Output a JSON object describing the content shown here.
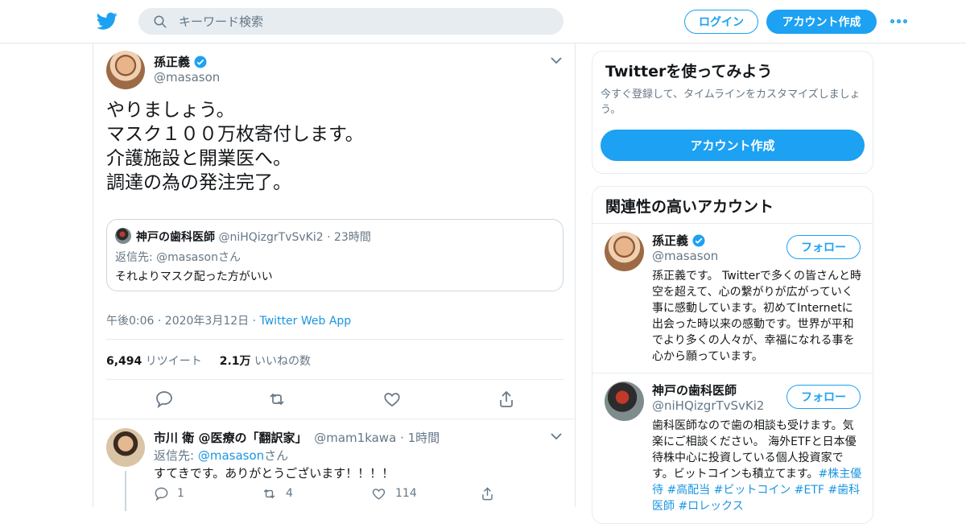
{
  "header": {
    "search_placeholder": "キーワード検索",
    "login_label": "ログイン",
    "signup_label": "アカウント作成"
  },
  "tweet": {
    "author_name": "孫正義",
    "author_handle": "@masason",
    "text_lines": [
      "やりましょう。",
      "マスク１００万枚寄付します。",
      "介護施設と開業医へ。",
      "調達の為の発注完了。"
    ],
    "quote": {
      "author_name": "神戸の歯科医師",
      "author_handle": "@niHQizgrTvSvKi2",
      "time": "23時間",
      "reply_to": "返信先: @masasonさん",
      "text": "それよりマスク配った方がいい"
    },
    "timestamp": "午後0:06 · 2020年3月12日",
    "source": "Twitter Web App",
    "retweets_count": "6,494",
    "retweets_label": "リツイート",
    "likes_count": "2.1万",
    "likes_label": "いいねの数"
  },
  "reply": {
    "author_name": "市川 衛 @医療の「翻訳家」",
    "author_handle": "@mam1kawa",
    "time": "1時間",
    "reply_to_prefix": "返信先: ",
    "reply_to_handle": "@masason",
    "reply_to_suffix": "さん",
    "text": "すてきです。ありがとうございます！！！！",
    "reply_count": "1",
    "retweet_count": "4",
    "like_count": "114"
  },
  "sidebar": {
    "signup_card": {
      "title": "Twitterを使ってみよう",
      "desc": "今すぐ登録して、タイムラインをカスタマイズしましょう。",
      "button_label": "アカウント作成"
    },
    "related": {
      "title": "関連性の高いアカウント",
      "follow_label": "フォロー",
      "accounts": [
        {
          "name": "孫正義",
          "handle": "@masason",
          "bio": "孫正義です。 Twitterで多くの皆さんと時空を超えて、心の繋がりが広がっていく事に感動しています。初めてInternetに出会った時以来の感動です。世界が平和でより多くの人々が、幸福になれる事を心から願っています。"
        },
        {
          "name": "神戸の歯科医師",
          "handle": "@niHQizgrTvSvKi2",
          "bio": "歯科医師なので歯の相談も受けます。気楽にご相談ください。 海外ETFと日本優待株中心に投資している個人投資家です。ビットコインも積立てます。",
          "tags": "#株主優待 #高配当 #ビットコイン #ETF #歯科医師 #ロレックス"
        }
      ]
    }
  },
  "colors": {
    "accent": "#1da1f2",
    "link": "#1b95e0",
    "muted": "#657786",
    "border": "#e6ecf0"
  }
}
